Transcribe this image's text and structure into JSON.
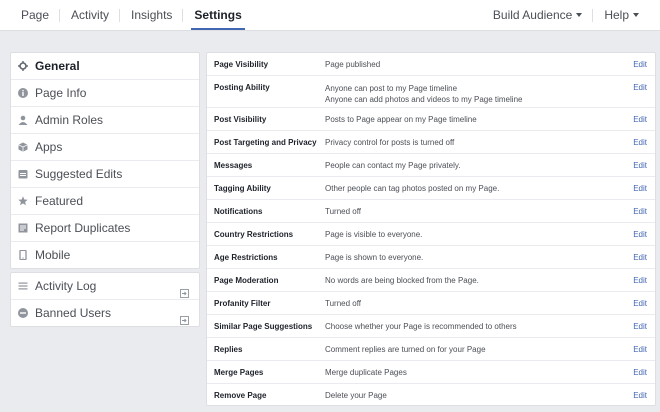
{
  "nav": {
    "tabs": [
      {
        "label": "Page"
      },
      {
        "label": "Activity"
      },
      {
        "label": "Insights"
      },
      {
        "label": "Settings"
      }
    ],
    "build_audience": "Build Audience",
    "help": "Help"
  },
  "sidebar": {
    "main": [
      {
        "label": "General",
        "icon": "gear-icon"
      },
      {
        "label": "Page Info",
        "icon": "info-icon"
      },
      {
        "label": "Admin Roles",
        "icon": "person-icon"
      },
      {
        "label": "Apps",
        "icon": "cube-icon"
      },
      {
        "label": "Suggested Edits",
        "icon": "suggested-edits-icon"
      },
      {
        "label": "Featured",
        "icon": "star-icon"
      },
      {
        "label": "Report Duplicates",
        "icon": "duplicates-icon"
      },
      {
        "label": "Mobile",
        "icon": "mobile-icon"
      }
    ],
    "sub": [
      {
        "label": "Activity Log",
        "icon": "list-icon"
      },
      {
        "label": "Banned Users",
        "icon": "ban-icon"
      }
    ]
  },
  "settings": {
    "edit_label": "Edit",
    "rows": [
      {
        "label": "Page Visibility",
        "value": "Page published",
        "value2": ""
      },
      {
        "label": "Posting Ability",
        "value": "Anyone can post to my Page timeline",
        "value2": "Anyone can add photos and videos to my Page timeline"
      },
      {
        "label": "Post Visibility",
        "value": "Posts to Page appear on my Page timeline",
        "value2": ""
      },
      {
        "label": "Post Targeting and Privacy",
        "value": "Privacy control for posts is turned off",
        "value2": ""
      },
      {
        "label": "Messages",
        "value": "People can contact my Page privately.",
        "value2": ""
      },
      {
        "label": "Tagging Ability",
        "value": "Other people can tag photos posted on my Page.",
        "value2": ""
      },
      {
        "label": "Notifications",
        "value": "Turned off",
        "value2": ""
      },
      {
        "label": "Country Restrictions",
        "value": "Page is visible to everyone.",
        "value2": ""
      },
      {
        "label": "Age Restrictions",
        "value": "Page is shown to everyone.",
        "value2": ""
      },
      {
        "label": "Page Moderation",
        "value": "No words are being blocked from the Page.",
        "value2": ""
      },
      {
        "label": "Profanity Filter",
        "value": "Turned off",
        "value2": ""
      },
      {
        "label": "Similar Page Suggestions",
        "value": "Choose whether your Page is recommended to others",
        "value2": ""
      },
      {
        "label": "Replies",
        "value": "Comment replies are turned on for your Page",
        "value2": ""
      },
      {
        "label": "Merge Pages",
        "value": "Merge duplicate Pages",
        "value2": ""
      },
      {
        "label": "Remove Page",
        "value": "Delete your Page",
        "value2": ""
      }
    ]
  },
  "colors": {
    "accent": "#4267b2",
    "background": "#e9ebee"
  }
}
